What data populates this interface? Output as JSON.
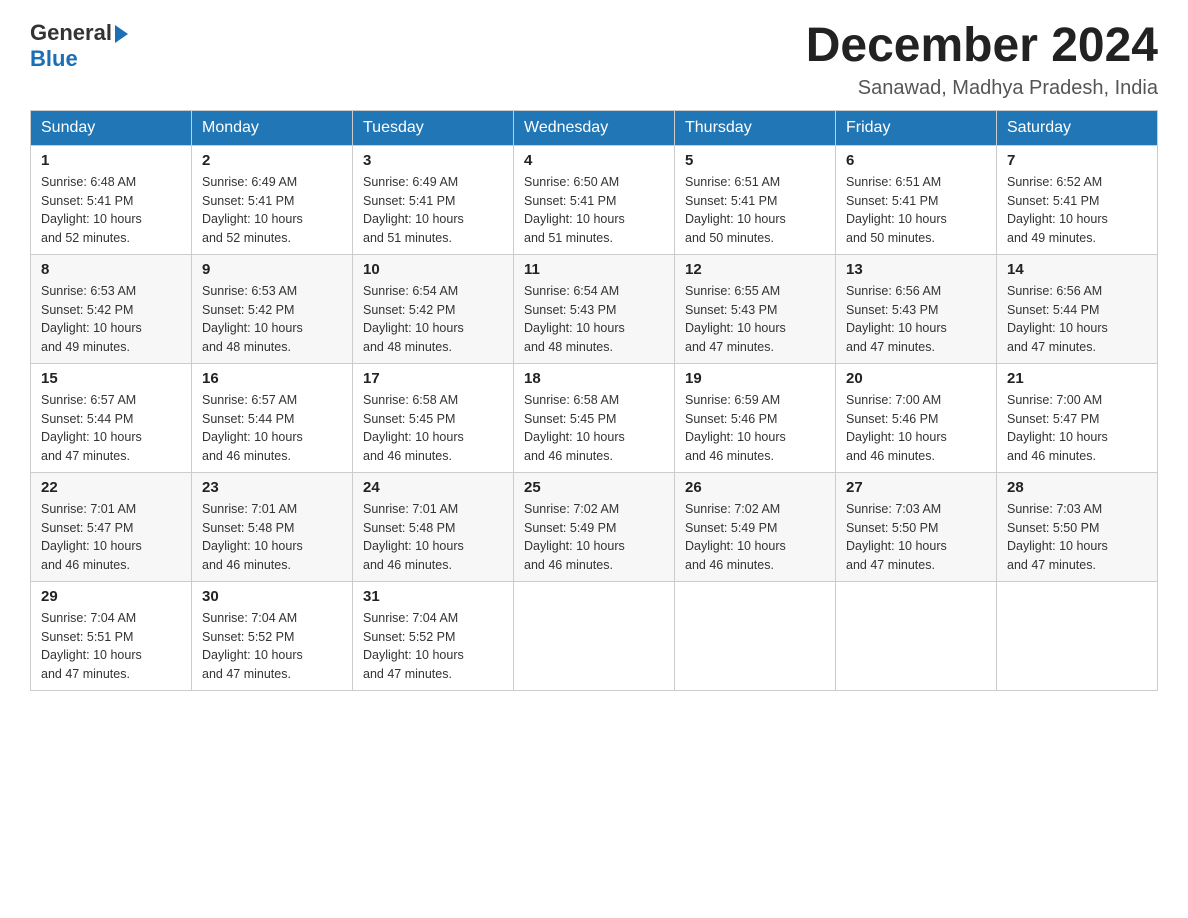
{
  "header": {
    "logo": {
      "general": "General",
      "arrow": "▶",
      "blue": "Blue"
    },
    "title": "December 2024",
    "location": "Sanawad, Madhya Pradesh, India"
  },
  "days_of_week": [
    "Sunday",
    "Monday",
    "Tuesday",
    "Wednesday",
    "Thursday",
    "Friday",
    "Saturday"
  ],
  "weeks": [
    [
      {
        "day": "1",
        "sunrise": "6:48 AM",
        "sunset": "5:41 PM",
        "daylight": "10 hours and 52 minutes."
      },
      {
        "day": "2",
        "sunrise": "6:49 AM",
        "sunset": "5:41 PM",
        "daylight": "10 hours and 52 minutes."
      },
      {
        "day": "3",
        "sunrise": "6:49 AM",
        "sunset": "5:41 PM",
        "daylight": "10 hours and 51 minutes."
      },
      {
        "day": "4",
        "sunrise": "6:50 AM",
        "sunset": "5:41 PM",
        "daylight": "10 hours and 51 minutes."
      },
      {
        "day": "5",
        "sunrise": "6:51 AM",
        "sunset": "5:41 PM",
        "daylight": "10 hours and 50 minutes."
      },
      {
        "day": "6",
        "sunrise": "6:51 AM",
        "sunset": "5:41 PM",
        "daylight": "10 hours and 50 minutes."
      },
      {
        "day": "7",
        "sunrise": "6:52 AM",
        "sunset": "5:41 PM",
        "daylight": "10 hours and 49 minutes."
      }
    ],
    [
      {
        "day": "8",
        "sunrise": "6:53 AM",
        "sunset": "5:42 PM",
        "daylight": "10 hours and 49 minutes."
      },
      {
        "day": "9",
        "sunrise": "6:53 AM",
        "sunset": "5:42 PM",
        "daylight": "10 hours and 48 minutes."
      },
      {
        "day": "10",
        "sunrise": "6:54 AM",
        "sunset": "5:42 PM",
        "daylight": "10 hours and 48 minutes."
      },
      {
        "day": "11",
        "sunrise": "6:54 AM",
        "sunset": "5:43 PM",
        "daylight": "10 hours and 48 minutes."
      },
      {
        "day": "12",
        "sunrise": "6:55 AM",
        "sunset": "5:43 PM",
        "daylight": "10 hours and 47 minutes."
      },
      {
        "day": "13",
        "sunrise": "6:56 AM",
        "sunset": "5:43 PM",
        "daylight": "10 hours and 47 minutes."
      },
      {
        "day": "14",
        "sunrise": "6:56 AM",
        "sunset": "5:44 PM",
        "daylight": "10 hours and 47 minutes."
      }
    ],
    [
      {
        "day": "15",
        "sunrise": "6:57 AM",
        "sunset": "5:44 PM",
        "daylight": "10 hours and 47 minutes."
      },
      {
        "day": "16",
        "sunrise": "6:57 AM",
        "sunset": "5:44 PM",
        "daylight": "10 hours and 46 minutes."
      },
      {
        "day": "17",
        "sunrise": "6:58 AM",
        "sunset": "5:45 PM",
        "daylight": "10 hours and 46 minutes."
      },
      {
        "day": "18",
        "sunrise": "6:58 AM",
        "sunset": "5:45 PM",
        "daylight": "10 hours and 46 minutes."
      },
      {
        "day": "19",
        "sunrise": "6:59 AM",
        "sunset": "5:46 PM",
        "daylight": "10 hours and 46 minutes."
      },
      {
        "day": "20",
        "sunrise": "7:00 AM",
        "sunset": "5:46 PM",
        "daylight": "10 hours and 46 minutes."
      },
      {
        "day": "21",
        "sunrise": "7:00 AM",
        "sunset": "5:47 PM",
        "daylight": "10 hours and 46 minutes."
      }
    ],
    [
      {
        "day": "22",
        "sunrise": "7:01 AM",
        "sunset": "5:47 PM",
        "daylight": "10 hours and 46 minutes."
      },
      {
        "day": "23",
        "sunrise": "7:01 AM",
        "sunset": "5:48 PM",
        "daylight": "10 hours and 46 minutes."
      },
      {
        "day": "24",
        "sunrise": "7:01 AM",
        "sunset": "5:48 PM",
        "daylight": "10 hours and 46 minutes."
      },
      {
        "day": "25",
        "sunrise": "7:02 AM",
        "sunset": "5:49 PM",
        "daylight": "10 hours and 46 minutes."
      },
      {
        "day": "26",
        "sunrise": "7:02 AM",
        "sunset": "5:49 PM",
        "daylight": "10 hours and 46 minutes."
      },
      {
        "day": "27",
        "sunrise": "7:03 AM",
        "sunset": "5:50 PM",
        "daylight": "10 hours and 47 minutes."
      },
      {
        "day": "28",
        "sunrise": "7:03 AM",
        "sunset": "5:50 PM",
        "daylight": "10 hours and 47 minutes."
      }
    ],
    [
      {
        "day": "29",
        "sunrise": "7:04 AM",
        "sunset": "5:51 PM",
        "daylight": "10 hours and 47 minutes."
      },
      {
        "day": "30",
        "sunrise": "7:04 AM",
        "sunset": "5:52 PM",
        "daylight": "10 hours and 47 minutes."
      },
      {
        "day": "31",
        "sunrise": "7:04 AM",
        "sunset": "5:52 PM",
        "daylight": "10 hours and 47 minutes."
      },
      null,
      null,
      null,
      null
    ]
  ],
  "labels": {
    "sunrise": "Sunrise:",
    "sunset": "Sunset:",
    "daylight": "Daylight:"
  }
}
